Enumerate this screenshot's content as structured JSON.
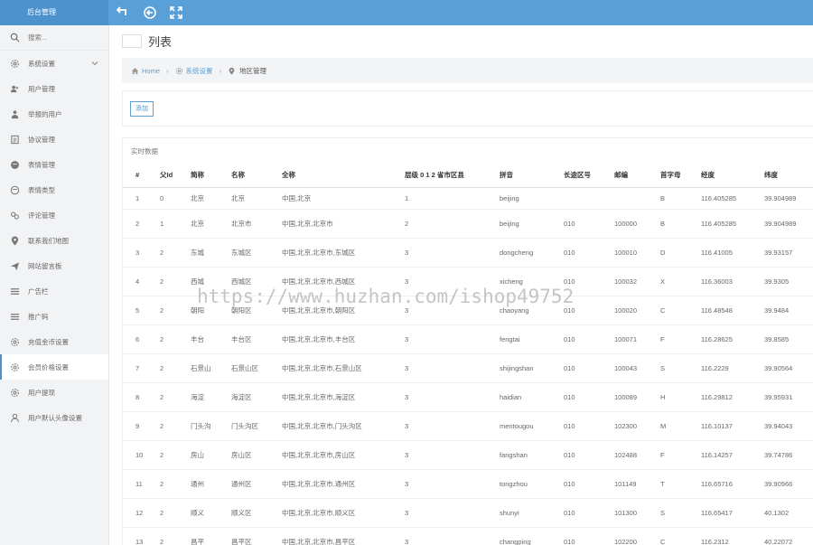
{
  "brand": {
    "title": "后台管理"
  },
  "sidebar": {
    "search_placeholder": "搜索...",
    "items": [
      {
        "label": "系统设置",
        "icon": "gear-icon",
        "expandable": true
      },
      {
        "label": "用户管理",
        "icon": "users-icon"
      },
      {
        "label": "举报的用户",
        "icon": "user-report-icon"
      },
      {
        "label": "协议管理",
        "icon": "document-icon"
      },
      {
        "label": "表情管理",
        "icon": "emoji-icon"
      },
      {
        "label": "表情类型",
        "icon": "emoji-type-icon"
      },
      {
        "label": "评论管理",
        "icon": "link-icon"
      },
      {
        "label": "联系我们地图",
        "icon": "map-marker-icon"
      },
      {
        "label": "网站留言板",
        "icon": "send-icon"
      },
      {
        "label": "广告栏",
        "icon": "bars-icon"
      },
      {
        "label": "推广码",
        "icon": "bars-icon"
      },
      {
        "label": "充值金币设置",
        "icon": "gear-icon"
      },
      {
        "label": "会员价格设置",
        "icon": "gear-icon",
        "active": true
      },
      {
        "label": "用户提现",
        "icon": "gear-icon"
      },
      {
        "label": "用户默认头像设置",
        "icon": "user-icon"
      }
    ]
  },
  "page": {
    "title": "列表"
  },
  "breadcrumb": {
    "home": "Home",
    "section": "系统设置",
    "current": "地区管理"
  },
  "toolbar": {
    "add_label": "添加"
  },
  "data_panel": {
    "title": "实时数据"
  },
  "table": {
    "headers": [
      "#",
      "父Id",
      "简称",
      "名称",
      "全称",
      "层级 0 1 2 省市区县",
      "拼音",
      "长途区号",
      "邮编",
      "首字母",
      "经度",
      "纬度"
    ],
    "rows": [
      [
        "1",
        "0",
        "北京",
        "北京",
        "中国,北京",
        "1",
        "beijing",
        "",
        "",
        "B",
        "116.405285",
        "39.904989"
      ],
      [
        "2",
        "1",
        "北京",
        "北京市",
        "中国,北京,北京市",
        "2",
        "beijing",
        "010",
        "100000",
        "B",
        "116.405285",
        "39.904989"
      ],
      [
        "3",
        "2",
        "东城",
        "东城区",
        "中国,北京,北京市,东城区",
        "3",
        "dongcheng",
        "010",
        "100010",
        "D",
        "116.41005",
        "39.93157"
      ],
      [
        "4",
        "2",
        "西城",
        "西城区",
        "中国,北京,北京市,西城区",
        "3",
        "xicheng",
        "010",
        "100032",
        "X",
        "116.36003",
        "39.9305"
      ],
      [
        "5",
        "2",
        "朝阳",
        "朝阳区",
        "中国,北京,北京市,朝阳区",
        "3",
        "chaoyang",
        "010",
        "100020",
        "C",
        "116.48548",
        "39.9484"
      ],
      [
        "6",
        "2",
        "丰台",
        "丰台区",
        "中国,北京,北京市,丰台区",
        "3",
        "fengtai",
        "010",
        "100071",
        "F",
        "116.28625",
        "39.8585"
      ],
      [
        "7",
        "2",
        "石景山",
        "石景山区",
        "中国,北京,北京市,石景山区",
        "3",
        "shijingshan",
        "010",
        "100043",
        "S",
        "116.2229",
        "39.90564"
      ],
      [
        "8",
        "2",
        "海淀",
        "海淀区",
        "中国,北京,北京市,海淀区",
        "3",
        "haidian",
        "010",
        "100089",
        "H",
        "116.29812",
        "39.95931"
      ],
      [
        "9",
        "2",
        "门头沟",
        "门头沟区",
        "中国,北京,北京市,门头沟区",
        "3",
        "mentougou",
        "010",
        "102300",
        "M",
        "116.10137",
        "39.94043"
      ],
      [
        "10",
        "2",
        "房山",
        "房山区",
        "中国,北京,北京市,房山区",
        "3",
        "fangshan",
        "010",
        "102488",
        "F",
        "116.14257",
        "39.74786"
      ],
      [
        "11",
        "2",
        "通州",
        "通州区",
        "中国,北京,北京市,通州区",
        "3",
        "tongzhou",
        "010",
        "101149",
        "T",
        "116.65716",
        "39.90966"
      ],
      [
        "12",
        "2",
        "顺义",
        "顺义区",
        "中国,北京,北京市,顺义区",
        "3",
        "shunyi",
        "010",
        "101300",
        "S",
        "116.65417",
        "40.1302"
      ],
      [
        "13",
        "2",
        "昌平",
        "昌平区",
        "中国,北京,北京市,昌平区",
        "3",
        "changping",
        "010",
        "102200",
        "C",
        "116.2312",
        "40.22072"
      ]
    ]
  },
  "watermark": "https://www.huzhan.com/ishop49752",
  "colors": {
    "accent": "#5aa0d8",
    "brand_bg": "#4d92cc"
  }
}
